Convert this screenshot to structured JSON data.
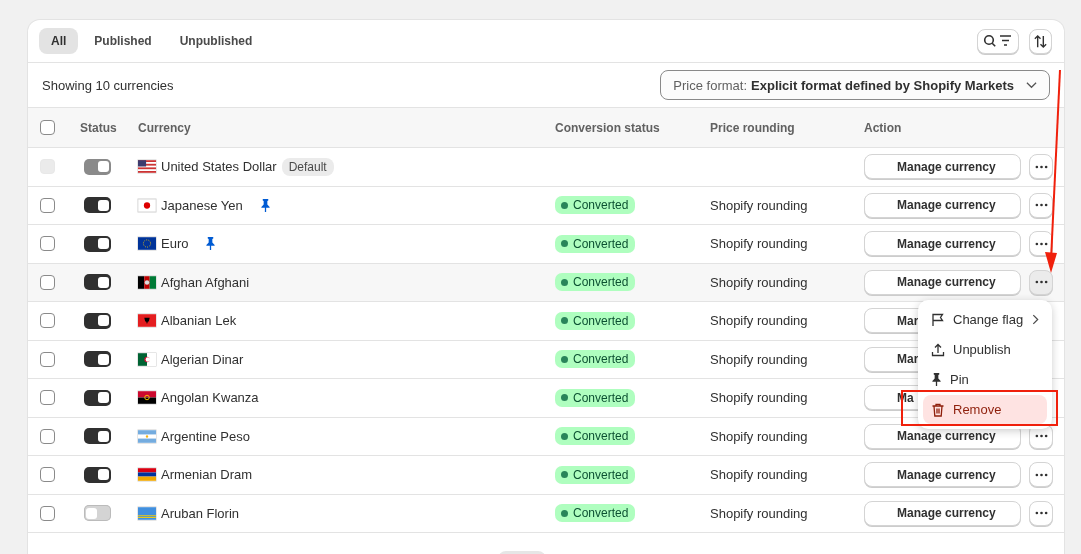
{
  "tabs": [
    {
      "label": "All",
      "selected": true
    },
    {
      "label": "Published",
      "selected": false
    },
    {
      "label": "Unpublished",
      "selected": false
    }
  ],
  "summary": "Showing 10 currencies",
  "price_format": {
    "label": "Price format:",
    "value": "Explicit format defined by Shopify Markets"
  },
  "select_all_checked": false,
  "table": {
    "columns": [
      "Status",
      "Currency",
      "Conversion status",
      "Price rounding",
      "Action"
    ],
    "rows": [
      {
        "checked": false,
        "checkbox_disabled": true,
        "toggle_on": true,
        "toggle_disabled": true,
        "kind": "us",
        "currency": "United States Dollar",
        "badge": "Default",
        "pinned": false,
        "conversion": "",
        "rounding": "",
        "action": "Manage currency",
        "more_button": true,
        "highlighted": false
      },
      {
        "checked": false,
        "checkbox_disabled": false,
        "toggle_on": true,
        "toggle_disabled": false,
        "kind": "jp",
        "currency": "Japanese Yen",
        "pinned": true,
        "conversion": "Converted",
        "rounding": "Shopify rounding",
        "action": "Manage currency",
        "more_button": true,
        "highlighted": false
      },
      {
        "checked": false,
        "checkbox_disabled": false,
        "toggle_on": true,
        "toggle_disabled": false,
        "kind": "eu",
        "currency": "Euro",
        "pinned": true,
        "conversion": "Converted",
        "rounding": "Shopify rounding",
        "action": "Manage currency",
        "more_button": true,
        "highlighted": false
      },
      {
        "checked": false,
        "checkbox_disabled": false,
        "toggle_on": true,
        "toggle_disabled": false,
        "kind": "af",
        "currency": "Afghan Afghani",
        "pinned": false,
        "conversion": "Converted",
        "rounding": "Shopify rounding",
        "action": "Manage currency",
        "more_button": true,
        "highlighted": true
      },
      {
        "checked": false,
        "checkbox_disabled": false,
        "toggle_on": true,
        "toggle_disabled": false,
        "kind": "al",
        "currency": "Albanian Lek",
        "pinned": false,
        "conversion": "Converted",
        "rounding": "Shopify rounding",
        "action": "Mar",
        "more_button": false,
        "highlighted": false
      },
      {
        "checked": false,
        "checkbox_disabled": false,
        "toggle_on": true,
        "toggle_disabled": false,
        "kind": "dz",
        "currency": "Algerian Dinar",
        "pinned": false,
        "conversion": "Converted",
        "rounding": "Shopify rounding",
        "action": "Mar",
        "more_button": false,
        "highlighted": false
      },
      {
        "checked": false,
        "checkbox_disabled": false,
        "toggle_on": true,
        "toggle_disabled": false,
        "kind": "ao",
        "currency": "Angolan Kwanza",
        "pinned": false,
        "conversion": "Converted",
        "rounding": "Shopify rounding",
        "action": "Ma",
        "more_button": false,
        "highlighted": false
      },
      {
        "checked": false,
        "checkbox_disabled": false,
        "toggle_on": true,
        "toggle_disabled": false,
        "kind": "ar",
        "currency": "Argentine Peso",
        "pinned": false,
        "conversion": "Converted",
        "rounding": "Shopify rounding",
        "action": "Manage currency",
        "more_button": true,
        "highlighted": false
      },
      {
        "checked": false,
        "checkbox_disabled": false,
        "toggle_on": true,
        "toggle_disabled": false,
        "kind": "am",
        "currency": "Armenian Dram",
        "pinned": false,
        "conversion": "Converted",
        "rounding": "Shopify rounding",
        "action": "Manage currency",
        "more_button": true,
        "highlighted": false
      },
      {
        "checked": false,
        "checkbox_disabled": false,
        "toggle_on": false,
        "toggle_disabled": false,
        "kind": "aw",
        "currency": "Aruban Florin",
        "pinned": false,
        "conversion": "Converted",
        "rounding": "Shopify rounding",
        "action": "Manage currency",
        "more_button": true,
        "highlighted": false
      }
    ]
  },
  "menu": {
    "items": [
      {
        "kind": "flag",
        "label": "Change flag",
        "submenu": true,
        "destructive": false
      },
      {
        "kind": "upload",
        "label": "Unpublish",
        "submenu": false,
        "destructive": false
      },
      {
        "kind": "pin",
        "label": "Pin",
        "submenu": false,
        "destructive": false
      },
      {
        "kind": "trash",
        "label": "Remove",
        "submenu": false,
        "destructive": true
      }
    ]
  },
  "annotations": {
    "arrow": true,
    "highlight_frame": true
  }
}
